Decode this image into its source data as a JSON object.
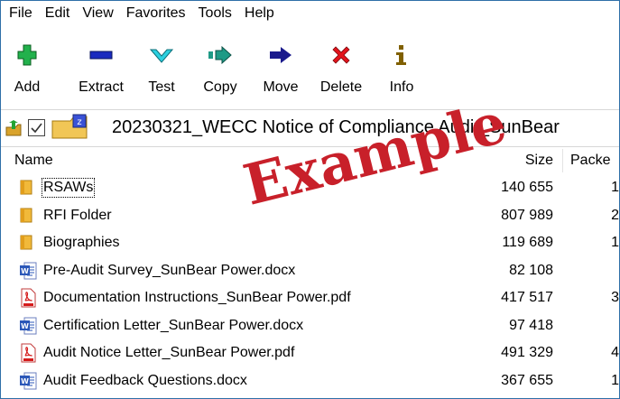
{
  "menu": [
    "File",
    "Edit",
    "View",
    "Favorites",
    "Tools",
    "Help"
  ],
  "toolbar": {
    "add": {
      "label": "Add",
      "icon": "plus-icon",
      "color": "#22b14c"
    },
    "extract": {
      "label": "Extract",
      "icon": "minus-icon",
      "color": "#1a2bbf"
    },
    "test": {
      "label": "Test",
      "icon": "check-icon",
      "color": "#2bd0e0"
    },
    "copy": {
      "label": "Copy",
      "icon": "double-arrow-icon",
      "color": "#1f9a86"
    },
    "move": {
      "label": "Move",
      "icon": "arrow-right-icon",
      "color": "#1a1a8c"
    },
    "delete": {
      "label": "Delete",
      "icon": "x-icon",
      "color": "#e3141c"
    },
    "info": {
      "label": "Info",
      "icon": "info-icon",
      "color": "#806000"
    }
  },
  "address": {
    "path": "20230321_WECC Notice of Compliance Audit_SunBear"
  },
  "columns": {
    "name": "Name",
    "size": "Size",
    "packed": "Packe"
  },
  "files": [
    {
      "name": "RSAWs",
      "size": "140 655",
      "packed": "1",
      "type": "folder"
    },
    {
      "name": "RFI Folder",
      "size": "807 989",
      "packed": "2",
      "type": "folder"
    },
    {
      "name": "Biographies",
      "size": "119 689",
      "packed": "1",
      "type": "folder"
    },
    {
      "name": "Pre-Audit Survey_SunBear Power.docx",
      "size": "82 108",
      "packed": "",
      "type": "docx"
    },
    {
      "name": "Documentation Instructions_SunBear Power.pdf",
      "size": "417 517",
      "packed": "3",
      "type": "pdf"
    },
    {
      "name": "Certification Letter_SunBear Power.docx",
      "size": "97 418",
      "packed": "",
      "type": "docx"
    },
    {
      "name": "Audit Notice Letter_SunBear Power.pdf",
      "size": "491 329",
      "packed": "4",
      "type": "pdf"
    },
    {
      "name": "Audit Feedback Questions.docx",
      "size": "367 655",
      "packed": "1",
      "type": "docx"
    }
  ],
  "watermark": "Example"
}
